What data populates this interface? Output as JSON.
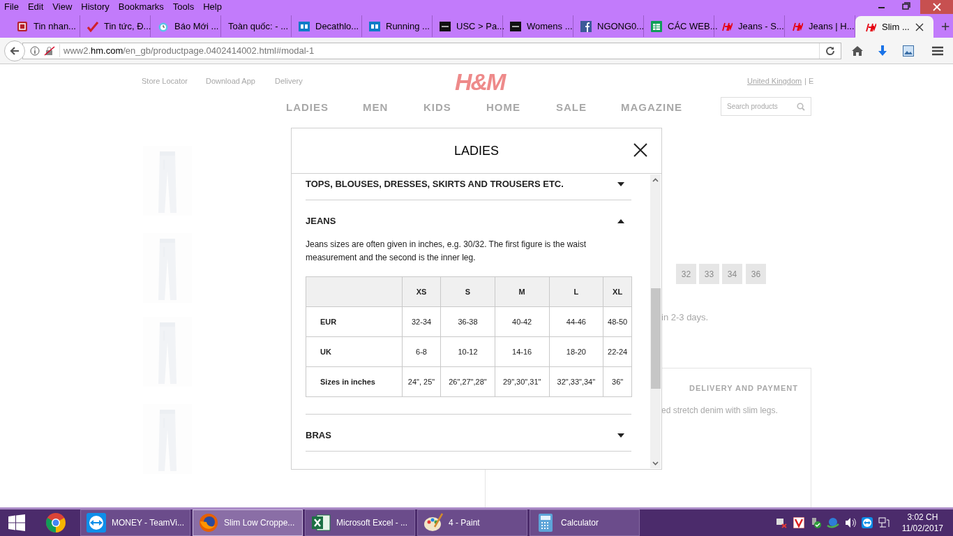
{
  "menu_bar": [
    "File",
    "Edit",
    "View",
    "History",
    "Bookmarks",
    "Tools",
    "Help"
  ],
  "tabs": [
    {
      "label": "Tin nhan...",
      "kind": "e-logo",
      "selected": false
    },
    {
      "label": "Tin tức, Đ...",
      "kind": "check",
      "selected": false
    },
    {
      "label": "Báo Mới ...",
      "kind": "clock",
      "selected": false
    },
    {
      "label": "Toàn quốc: - ...",
      "kind": "plain",
      "selected": false
    },
    {
      "label": "Decathlo...",
      "kind": "de",
      "selected": false
    },
    {
      "label": "Running ...",
      "kind": "de",
      "selected": false
    },
    {
      "label": "USC > Pa...",
      "kind": "dark",
      "selected": false
    },
    {
      "label": "Womens ...",
      "kind": "dark",
      "selected": false
    },
    {
      "label": "NGONG0...",
      "kind": "facebook",
      "selected": false
    },
    {
      "label": "CÁC WEB...",
      "kind": "sheet",
      "selected": false
    },
    {
      "label": "Jeans - S...",
      "kind": "hm",
      "selected": false
    },
    {
      "label": "Jeans | H...",
      "kind": "hm",
      "selected": false
    },
    {
      "label": "Slim ...",
      "kind": "hm",
      "selected": true
    }
  ],
  "address_bar": {
    "host_prefix": "www2.",
    "host": "hm.com",
    "path": "/en_gb/productpage.0402414002.html#modal-1"
  },
  "background_page": {
    "header_links": [
      "Store Locator",
      "Download App",
      "Delivery"
    ],
    "logo": "H&M",
    "region_link": "United Kingdom",
    "region_extra": "| E",
    "nav": [
      "LADIES",
      "MEN",
      "KIDS",
      "HOME",
      "SALE",
      "MAGAZINE"
    ],
    "search": {
      "placeholder": "Search products"
    },
    "sizes": [
      "32",
      "33",
      "34",
      "36"
    ],
    "delivery_note": "in 2-3 days.",
    "info_tab": "DELIVERY AND PAYMENT",
    "description": "ed stretch denim with slim legs."
  },
  "modal": {
    "title": "LADIES",
    "sections": [
      {
        "title": "TOPS, BLOUSES, DRESSES, SKIRTS AND TROUSERS ETC.",
        "expanded": false
      },
      {
        "title": "JEANS",
        "expanded": true,
        "text": "Jeans sizes are often given in inches, e.g. 30/32. The first figure is the waist measurement and the second is the inner leg.",
        "table": {
          "columns": [
            "",
            "XS",
            "S",
            "M",
            "L",
            "XL"
          ],
          "rows": [
            [
              "EUR",
              "32-34",
              "36-38",
              "40-42",
              "44-46",
              "48-50"
            ],
            [
              "UK",
              "6-8",
              "10-12",
              "14-16",
              "18-20",
              "22-24"
            ],
            [
              "Sizes in inches",
              "24\", 25\"",
              "26\",27\",28\"",
              "29\",30\",31\"",
              "32\",33\",34\"",
              "36\""
            ]
          ]
        }
      },
      {
        "title": "BRAS",
        "expanded": false
      }
    ]
  },
  "taskbar": {
    "windows": [
      {
        "label": "MONEY - TeamVi...",
        "kind": "teamviewer",
        "selected": false
      },
      {
        "label": "Slim Low Croppe...",
        "kind": "firefox",
        "selected": true
      },
      {
        "label": "Microsoft Excel - ...",
        "kind": "excel",
        "selected": false
      },
      {
        "label": "4 - Paint",
        "kind": "paint",
        "selected": false
      },
      {
        "label": "Calculator",
        "kind": "calculator",
        "selected": false
      }
    ],
    "time": "3:02 CH",
    "date": "11/02/2017"
  }
}
